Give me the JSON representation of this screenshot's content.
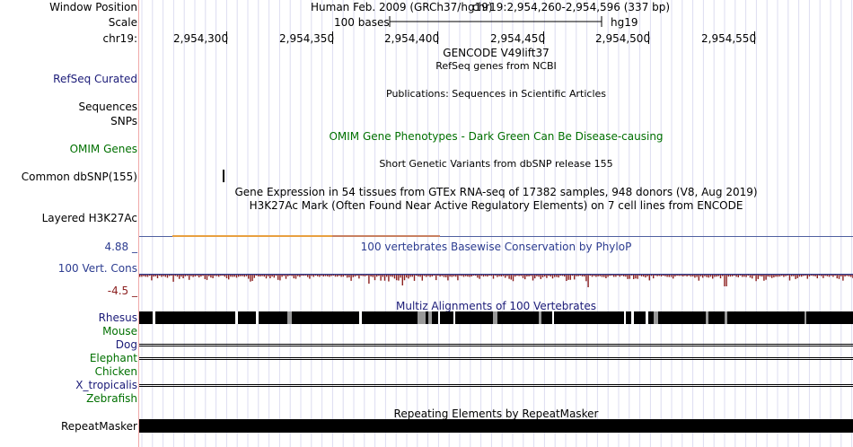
{
  "window_position": {
    "label": "Window Position",
    "assembly": "Human Feb. 2009 (GRCh37/hg19)",
    "range": "chr19:2,954,260-2,954,596 (337 bp)"
  },
  "scale": {
    "label": "Scale",
    "bar_text": "100 bases",
    "db": "hg19"
  },
  "chrom": {
    "label": "chr19:",
    "ticks": [
      "2,954,300",
      "2,954,350",
      "2,954,400",
      "2,954,450",
      "2,954,500",
      "2,954,550"
    ]
  },
  "tracks": {
    "gencode_title": "GENCODE V49lift37",
    "refseq_title": "RefSeq genes from NCBI",
    "refseq_label": "RefSeq Curated",
    "publications_title": "Publications: Sequences in Scientific Articles",
    "sequences_label": "Sequences",
    "snps_label": "SNPs",
    "omim_title": "OMIM Gene Phenotypes - Dark Green Can Be Disease-causing",
    "omim_label": "OMIM Genes",
    "dbsnp_title": "Short Genetic Variants from dbSNP release 155",
    "dbsnp_label": "Common dbSNP(155)",
    "gtex_title": "Gene Expression in 54 tissues from GTEx RNA-seq of 17382 samples, 948 donors (V8, Aug 2019)",
    "h3k27ac_title": "H3K27Ac Mark (Often Found Near Active Regulatory Elements) on 7 cell lines from ENCODE",
    "h3k27ac_label": "Layered H3K27Ac",
    "cons_title": "100 vertebrates Basewise Conservation by PhyloP",
    "cons_label": "100 Vert. Cons",
    "cons_max": "4.88 _",
    "cons_min": "-4.5 _",
    "multiz_title": "Multiz Alignments of 100 Vertebrates",
    "species": [
      "Rhesus",
      "Mouse",
      "Dog",
      "Elephant",
      "Chicken",
      "X_tropicalis",
      "Zebrafish"
    ],
    "repeat_title": "Repeating Elements by RepeatMasker",
    "repeat_label": "RepeatMasker"
  },
  "colors": {
    "omim_green": "#007000",
    "refseq_navy": "#1b1b78",
    "cons_blue": "#2c3c90",
    "cons_red": "#8c2020",
    "h3k27ac_orange": "#e8a040",
    "gridline": "#dcdcf0"
  }
}
